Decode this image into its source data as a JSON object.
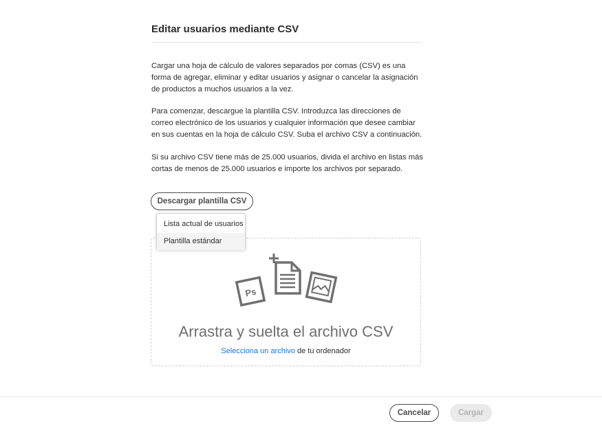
{
  "dialog": {
    "title": "Editar usuarios mediante CSV",
    "paragraphs": [
      "Cargar una hoja de cálculo de valores separados por comas (CSV) es una forma de agregar, eliminar y editar usuarios y asignar o cancelar la asignación de productos a muchos usuarios a la vez.",
      "Para comenzar, descargue la plantilla CSV. Introduzca las direcciones de correo electrónico de los usuarios y cualquier información que desee cambiar en sus cuentas en la hoja de cálculo CSV. Suba el archivo CSV a continuación.",
      "Si su archivo CSV tiene más de 25.000 usuarios, divida el archivo en listas más cortas de menos de 25.000 usuarios e importe los archivos por separado."
    ],
    "download_button": "Descargar plantilla CSV",
    "download_menu": [
      "Lista actual de usuarios",
      "Plantilla estándar"
    ],
    "dropzone": {
      "main_text": "Arrastra y suelta el archivo CSV",
      "link_text": "Selecciona un archivo",
      "suffix_text": " de tu ordenador"
    }
  },
  "footer": {
    "cancel": "Cancelar",
    "upload": "Cargar"
  },
  "colors": {
    "link": "#1473e6",
    "disabled_bg": "#eaeaea",
    "disabled_text": "#b3b3b3",
    "icon_gray": "#707070"
  },
  "icons": [
    "photoshop-file-icon",
    "add-document-icon",
    "image-file-icon"
  ]
}
